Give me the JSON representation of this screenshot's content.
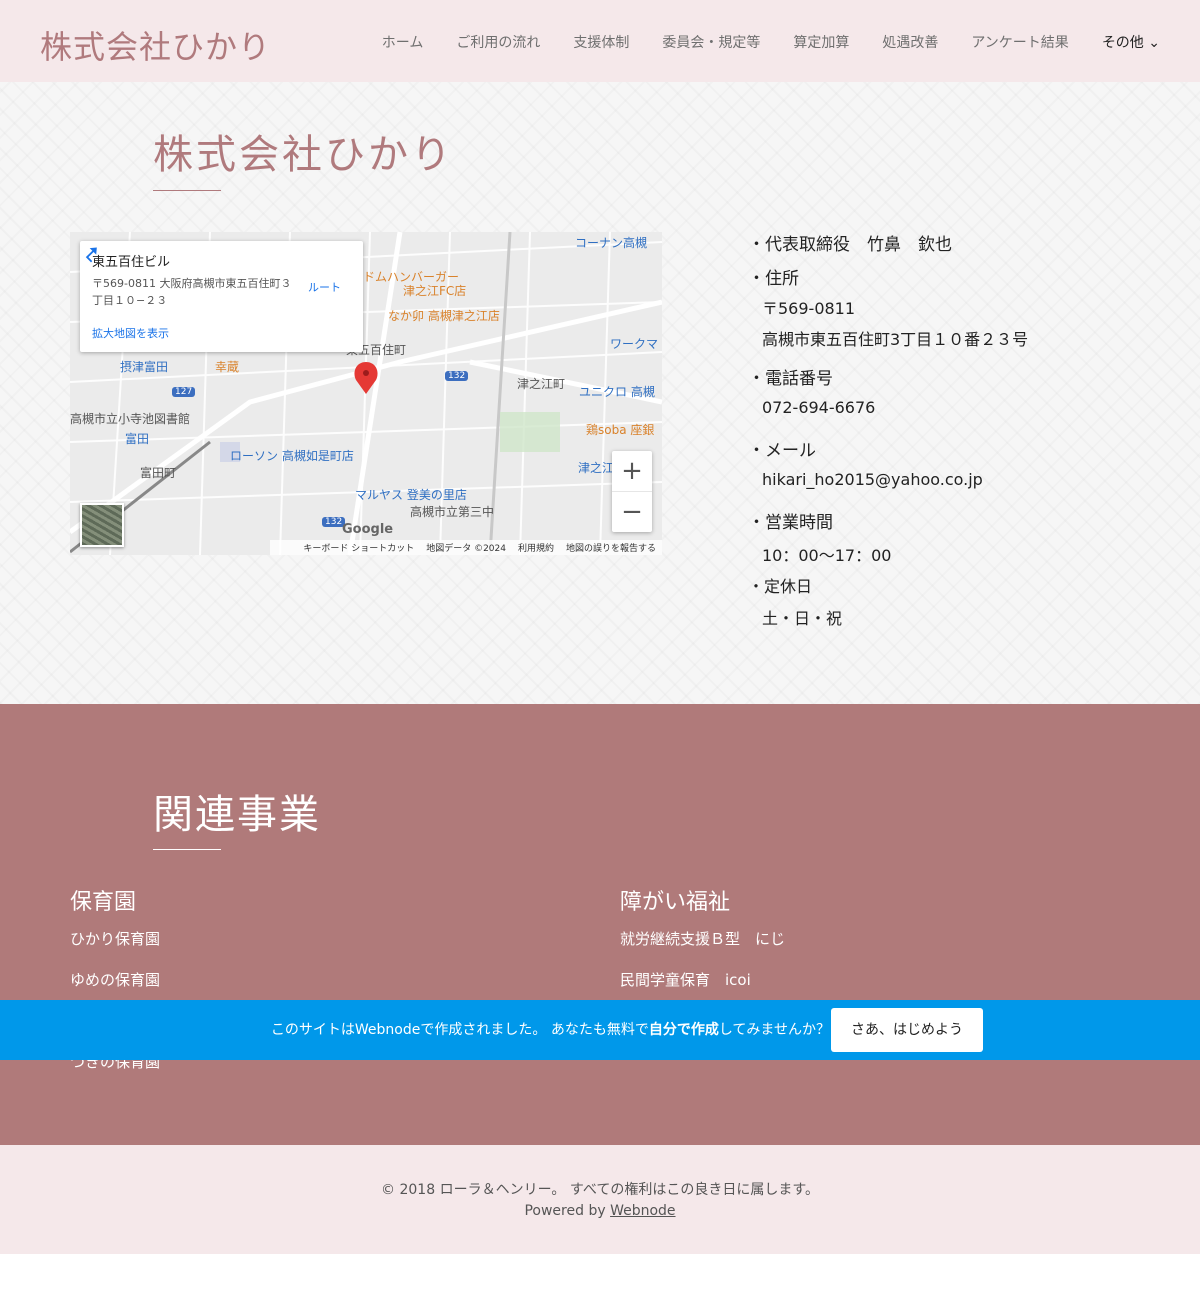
{
  "header": {
    "logo": "株式会社ひかり",
    "nav": [
      "ホーム",
      "ご利用の流れ",
      "支援体制",
      "委員会・規定等",
      "算定加算",
      "処遇改善",
      "アンケート結果"
    ],
    "more_label": "その他"
  },
  "main": {
    "title": "株式会社ひかり",
    "map": {
      "card_title": "東五百住ビル",
      "card_address": "〒569-0811 大阪府高槻市東五百住町３丁目１０−２３",
      "card_link": "拡大地図を表示",
      "route_label": "ルート",
      "zoom_in": "+",
      "zoom_out": "−",
      "google": "Google",
      "footer": [
        "キーボード ショートカット",
        "地図データ ©2024",
        "利用規約",
        "地図の誤りを報告する"
      ],
      "labels": {
        "l1": "コーナン高槻",
        "l2": "ドムハンバーガー",
        "l3": "津之江FC店",
        "l4": "なか卯 高槻津之江店",
        "l5": "東五百住町",
        "l6": "ワークマ",
        "l7": "摂津富田",
        "l8": "幸蔵",
        "l9": "津之江町",
        "l10": "ユニクロ 高槻",
        "l11": "高槻市立小寺池図書館",
        "l12": "富田",
        "l13": "鶏soba 座銀",
        "l14": "ローソン 高槻如是町店",
        "l15": "富田町",
        "l16": "津之江",
        "l17": "マルヤス 登美の里店",
        "l18": "高槻市立第三中",
        "l19": "132",
        "l20": "127",
        "l21": "132"
      }
    },
    "info": {
      "rep_label": "・代表取締役　竹鼻　欽也",
      "addr_label": "・住所",
      "zip": "〒569-0811",
      "address": "高槻市東五百住町3丁目１０番２３号",
      "tel_label": "・電話番号",
      "tel": "072-694-6676",
      "mail_label": "・メール",
      "mail": "hikari_ho2015@yahoo.co.jp",
      "hours_label": "・営業時間",
      "hours": "10：00～17：00",
      "holiday_label": "・定休日",
      "holiday": "土・日・祝"
    }
  },
  "related": {
    "title": "関連事業",
    "col1_head": "保育園",
    "col1_items": [
      "ひかり保育園",
      "ゆめの保育園",
      "つきの保育園"
    ],
    "col2_head": "障がい福祉",
    "col2_items": [
      "就労継続支援Ｂ型　にじ",
      "民間学童保育　icoi"
    ]
  },
  "banner": {
    "text_pre": "このサイトはWebnodeで作成されました。 あなたも無料で",
    "text_bold": "自分で作成",
    "text_post": "してみませんか？",
    "button": "さあ、はじめよう"
  },
  "footer": {
    "copyright": "© 2018 ローラ＆ヘンリー。 すべての権利はこの良き日に属します。",
    "powered_prefix": "Powered by ",
    "powered_link": "Webnode"
  },
  "colors": {
    "accent": "#b07a7d",
    "related_bg": "#b07a7a",
    "header_bg": "#f5e8ea",
    "banner_bg": "#0098ea"
  }
}
